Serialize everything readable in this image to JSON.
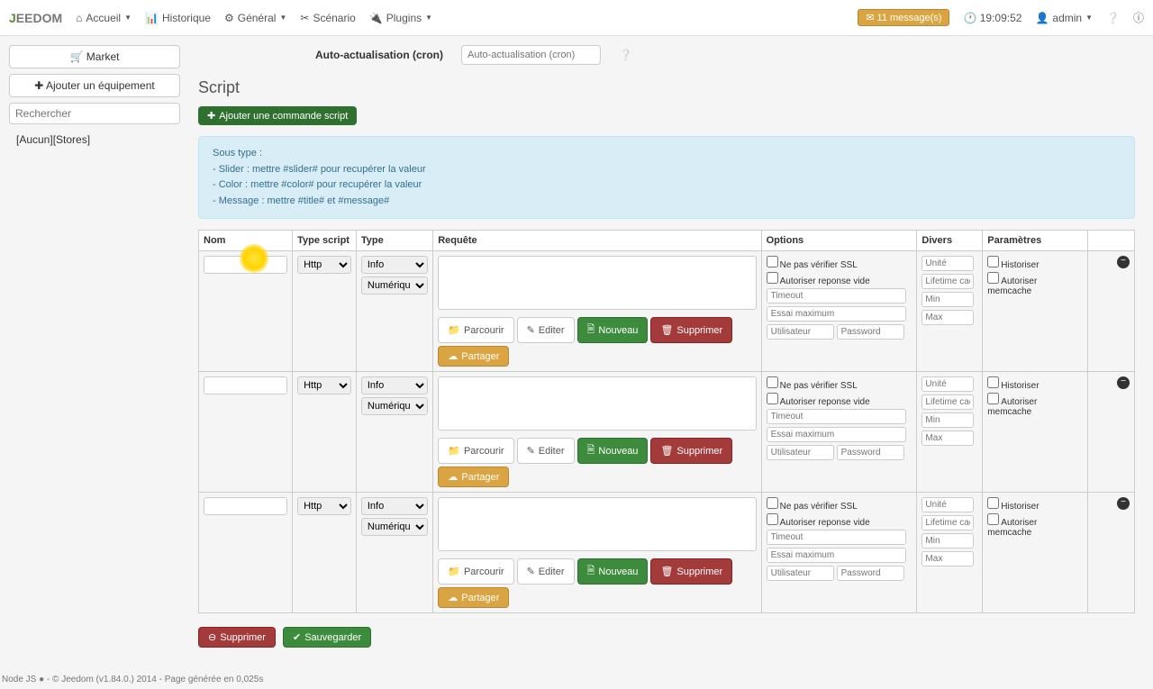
{
  "logo": "EEDOM",
  "nav": {
    "accueil": "Accueil",
    "historique": "Historique",
    "general": "Général",
    "scenario": "Scénario",
    "plugins": "Plugins"
  },
  "topright": {
    "messages": "11 message(s)",
    "clock": "19:09:52",
    "user": "admin"
  },
  "sidebar": {
    "market": "Market",
    "add_equip": "Ajouter un équipement",
    "search_ph": "Rechercher",
    "item1": "[Aucun][Stores]"
  },
  "cron": {
    "label": "Auto-actualisation (cron)",
    "placeholder": "Auto-actualisation (cron)"
  },
  "section_title": "Script",
  "add_cmd": "Ajouter une commande script",
  "infobox": {
    "l1": "Sous type :",
    "l2": "- Slider : mettre #slider# pour recupérer la valeur",
    "l3": "- Color : mettre #color# pour recupérer la valeur",
    "l4": "- Message : mettre #title# et #message#"
  },
  "headers": {
    "nom": "Nom",
    "typescript": "Type script",
    "type": "Type",
    "requete": "Requête",
    "options": "Options",
    "divers": "Divers",
    "parametres": "Paramètres"
  },
  "select": {
    "http": "Http",
    "info": "Info",
    "numerique": "Numérique"
  },
  "btns": {
    "parcourir": "Parcourir",
    "editer": "Editer",
    "nouveau": "Nouveau",
    "supprimer": "Supprimer",
    "partager": "Partager",
    "sauvegarder": "Sauvegarder"
  },
  "opts": {
    "nossl": "Ne pas vérifier SSL",
    "allowempty": "Autoriser reponse vide",
    "timeout_ph": "Timeout",
    "maxtry_ph": "Essai maximum",
    "user_ph": "Utilisateur",
    "pass_ph": "Password"
  },
  "divers": {
    "unite": "Unité",
    "lifetime": "Lifetime cache",
    "min": "Min",
    "max": "Max"
  },
  "params": {
    "historiser": "Historiser",
    "memcache": "Autoriser memcache"
  },
  "footer_txt": "Node JS ● - © Jeedom (v1.84.0.) 2014 - Page générée en 0,025s"
}
